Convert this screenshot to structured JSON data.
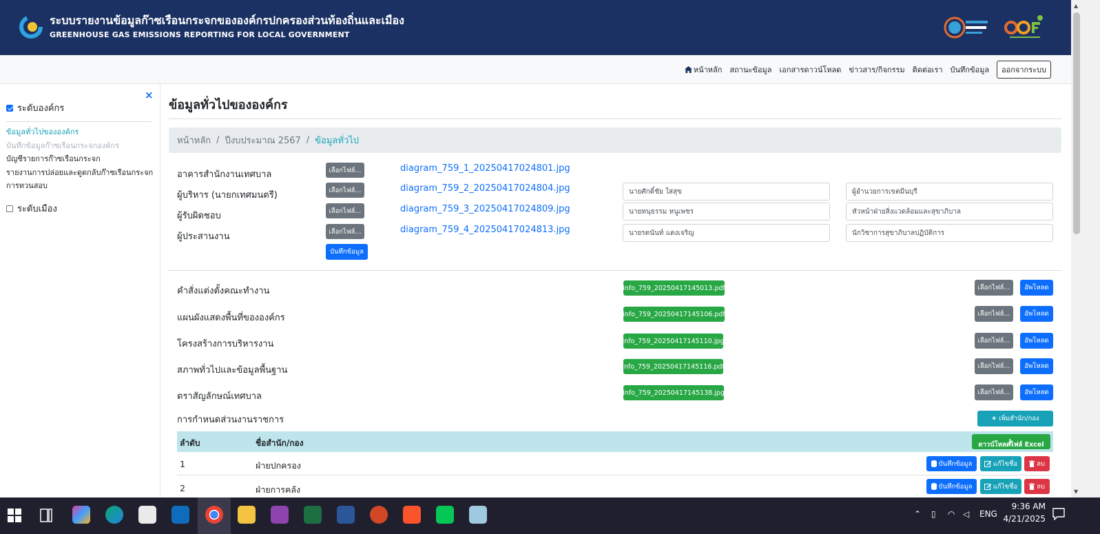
{
  "header": {
    "title_th": "ระบบรายงานข้อมูลก๊าซเรือนกระจกขององค์กรปกครองส่วนท้องถิ่นและเมือง",
    "title_en": "GREENHOUSE GAS EMISSIONS REPORTING FOR LOCAL GOVERNMENT"
  },
  "nav": {
    "items": [
      "หน้าหลัก",
      "สถานะข้อมูล",
      "เอกสารดาวน์โหลด",
      "ข่าวสาร/กิจกรรม",
      "ติดต่อเรา",
      "บันทึกข้อมูล"
    ],
    "logout": "ออกจากระบบ"
  },
  "sidebar": {
    "close": "×",
    "org_level": "ระดับองค์กร",
    "menu": [
      "ข้อมูลทั่วไปขององค์กร",
      "บันทึกข้อมูลก๊าซเรือนกระจกองค์กร",
      "บัญชีรายการก๊าซเรือนกระจก",
      "รายงานการปล่อยและดูดกลับก๊าซเรือนกระจก",
      "การทวนสอบ"
    ],
    "city_level": "ระดับเมือง"
  },
  "page": {
    "title": "ข้อมูลทั่วไปขององค์กร",
    "breadcrumb": [
      "หน้าหลัก",
      "ปีงบประมาณ 2567",
      "ข้อมูลทั่วไป"
    ]
  },
  "photos": {
    "choose_label": "เลือกไฟล์...",
    "save_label": "บันทึกข้อมูล",
    "rows": [
      {
        "label": "อาคารสำนักงานเทศบาล",
        "file": "diagram_759_1_20250417024801.jpg",
        "name": "",
        "position": ""
      },
      {
        "label": "ผู้บริหาร (นายกเทศมนตรี)",
        "file": "diagram_759_2_20250417024804.jpg",
        "name": "นายศักดิ์ชัย ใสสุข",
        "position": "ผู้อำนวยการเขตมีนบุรี"
      },
      {
        "label": "ผู้รับผิดชอบ",
        "file": "diagram_759_3_20250417024809.jpg",
        "name": "นายทนุธรรม หนูเพชร",
        "position": "หัวหน้าฝ่ายสิ่งแวดล้อมและสุขาภิบาล"
      },
      {
        "label": "ผู้ประสานงาน",
        "file": "diagram_759_4_20250417024813.jpg",
        "name": "นายรตนันท์ แตงเจริญ",
        "position": "นักวิชาการสุขาภิบาลปฏิบัติการ"
      }
    ]
  },
  "documents": {
    "choose_label": "เลือกไฟล์...",
    "upload_label": "อัพโหลด",
    "rows": [
      {
        "label": "คำสั่งแต่งตั้งคณะทำงาน",
        "file": "info_759_20250417145013.pdf"
      },
      {
        "label": "แผนผังแสดงพื้นที่ขององค์กร",
        "file": "info_759_20250417145106.pdf"
      },
      {
        "label": "โครงสร้างการบริหารงาน",
        "file": "info_759_20250417145110.jpg"
      },
      {
        "label": "สภาพทั่วไปและข้อมูลพื้นฐาน",
        "file": "info_759_20250417145116.pdf"
      },
      {
        "label": "ตราสัญลักษณ์เทศบาล",
        "file": "info_759_20250417145138.jpg"
      }
    ]
  },
  "units": {
    "title": "การกำหนดส่วนงานราชการ",
    "add_label": "เพิ่มสำนัก/กอง",
    "download_label": "ดาวน์โหลดไฟล์ Excel",
    "col_no": "ลำดับ",
    "col_name": "ชื่อสำนัก/กอง",
    "save_label": "บันทึกข้อมูล",
    "edit_label": "แก้ไขชื่อ",
    "delete_label": "ลบ",
    "rows": [
      {
        "no": "1",
        "name": "ฝ่ายปกครอง"
      },
      {
        "no": "2",
        "name": "ฝ่ายการคลัง"
      }
    ]
  },
  "taskbar": {
    "lang": "ENG",
    "time": "9:36 AM",
    "date": "4/21/2025"
  }
}
